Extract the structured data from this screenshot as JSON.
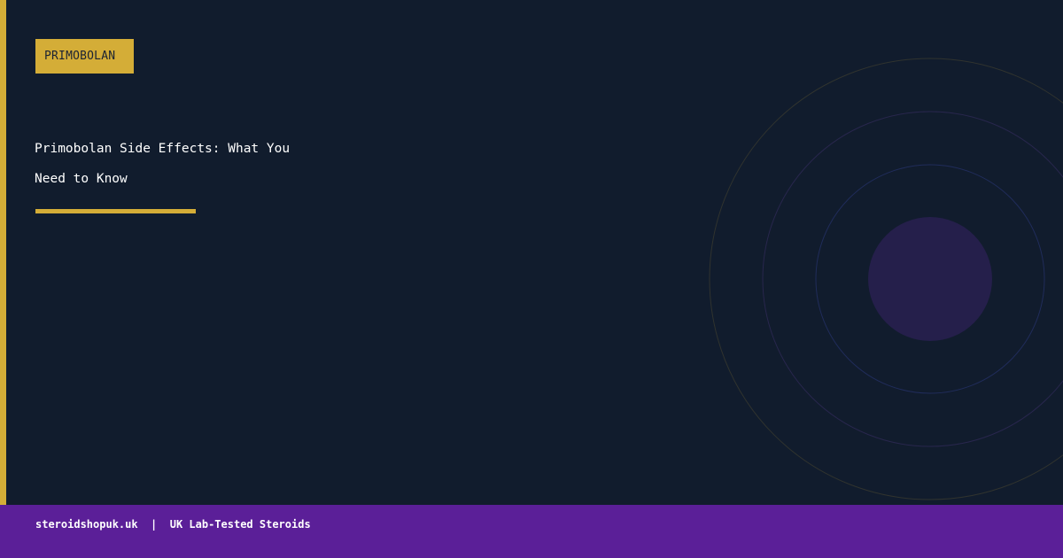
{
  "tag": {
    "label": "PRIMOBOLAN"
  },
  "article": {
    "title": "Primobolan Side Effects: What You Need to Know"
  },
  "footer": {
    "site": "steroidshopuk.uk",
    "separator": "|",
    "tagline": "UK Lab-Tested Steroids"
  },
  "colors": {
    "background": "#111c2d",
    "accent_gold": "#d4ad37",
    "footer_purple": "#5b1f98",
    "circle_fill": "#251f4b"
  },
  "icons": {
    "decoration": "concentric-circles-graphic"
  }
}
